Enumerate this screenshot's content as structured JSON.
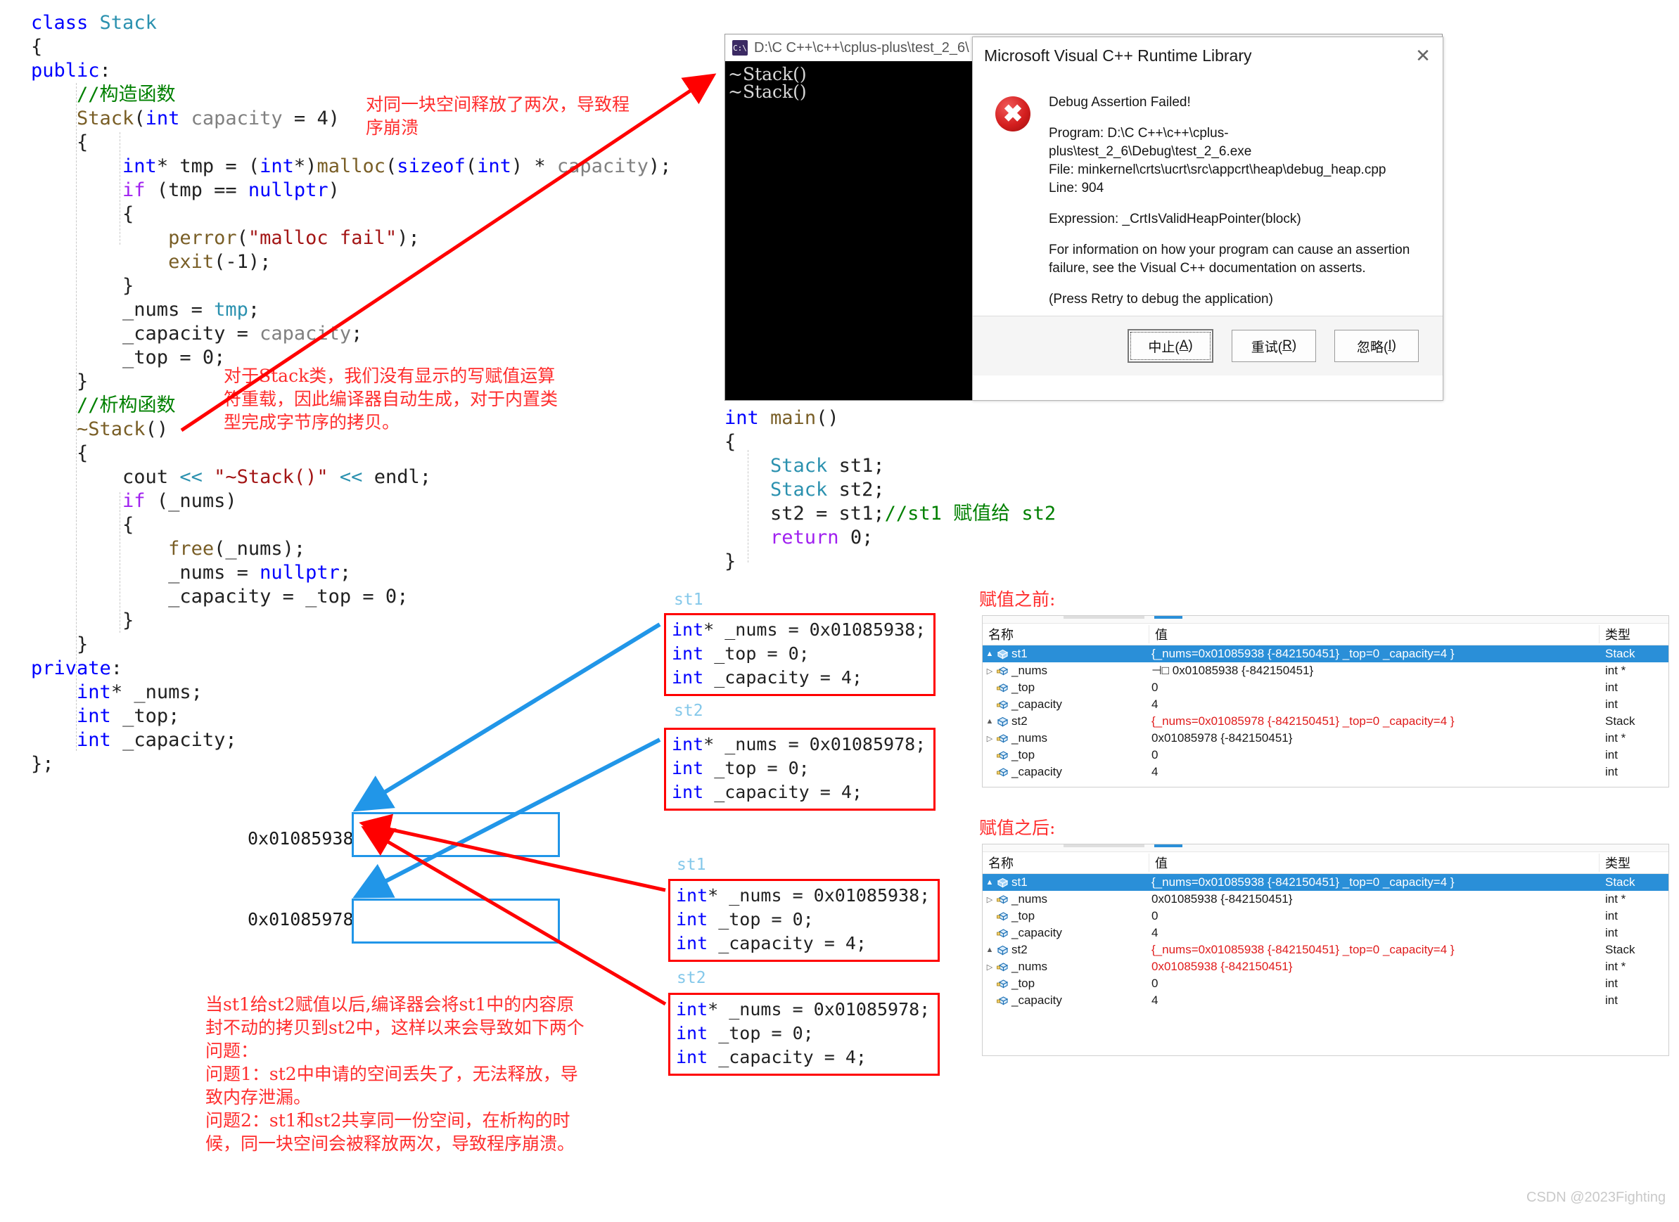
{
  "code_left": {
    "lines": [
      [
        {
          "t": "class ",
          "c": "kw"
        },
        {
          "t": "Stack",
          "c": "type"
        }
      ],
      [
        {
          "t": "{",
          "c": "plain"
        }
      ],
      [
        {
          "t": "public",
          "c": "kw"
        },
        {
          "t": ":",
          "c": "plain"
        }
      ],
      [
        {
          "t": "    //构造函数",
          "c": "cmt"
        }
      ],
      [
        {
          "t": "    ",
          "c": "plain"
        },
        {
          "t": "Stack",
          "c": "fn"
        },
        {
          "t": "(",
          "c": "plain"
        },
        {
          "t": "int ",
          "c": "kw"
        },
        {
          "t": "capacity",
          "c": "param"
        },
        {
          "t": " = ",
          "c": "plain"
        },
        {
          "t": "4",
          "c": "plain"
        },
        {
          "t": ")",
          "c": "plain"
        }
      ],
      [
        {
          "t": "    {",
          "c": "plain"
        }
      ],
      [
        {
          "t": "        ",
          "c": "plain"
        },
        {
          "t": "int",
          "c": "kw"
        },
        {
          "t": "* tmp = (",
          "c": "plain"
        },
        {
          "t": "int",
          "c": "kw"
        },
        {
          "t": "*)",
          "c": "plain"
        },
        {
          "t": "malloc",
          "c": "fn"
        },
        {
          "t": "(",
          "c": "plain"
        },
        {
          "t": "sizeof",
          "c": "kw"
        },
        {
          "t": "(",
          "c": "plain"
        },
        {
          "t": "int",
          "c": "kw"
        },
        {
          "t": ") * ",
          "c": "plain"
        },
        {
          "t": "capacity",
          "c": "param"
        },
        {
          "t": ");",
          "c": "plain"
        }
      ],
      [
        {
          "t": "        ",
          "c": "plain"
        },
        {
          "t": "if",
          "c": "kw2"
        },
        {
          "t": " (tmp == ",
          "c": "plain"
        },
        {
          "t": "nullptr",
          "c": "kw"
        },
        {
          "t": ")",
          "c": "plain"
        }
      ],
      [
        {
          "t": "        {",
          "c": "plain"
        }
      ],
      [
        {
          "t": "            ",
          "c": "plain"
        },
        {
          "t": "perror",
          "c": "fn"
        },
        {
          "t": "(",
          "c": "plain"
        },
        {
          "t": "\"malloc fail\"",
          "c": "str"
        },
        {
          "t": ");",
          "c": "plain"
        }
      ],
      [
        {
          "t": "            ",
          "c": "plain"
        },
        {
          "t": "exit",
          "c": "fn"
        },
        {
          "t": "(-1);",
          "c": "plain"
        }
      ],
      [
        {
          "t": "        }",
          "c": "plain"
        }
      ],
      [
        {
          "t": "        _nums = ",
          "c": "plain"
        },
        {
          "t": "tmp",
          "c": "type"
        },
        {
          "t": ";",
          "c": "plain"
        }
      ],
      [
        {
          "t": "        _capacity = ",
          "c": "plain"
        },
        {
          "t": "capacity",
          "c": "param"
        },
        {
          "t": ";",
          "c": "plain"
        }
      ],
      [
        {
          "t": "        _top = ",
          "c": "plain"
        },
        {
          "t": "0",
          "c": "plain"
        },
        {
          "t": ";",
          "c": "plain"
        }
      ],
      [
        {
          "t": "    }",
          "c": "plain"
        }
      ],
      [
        {
          "t": "    //析构函数",
          "c": "cmt"
        }
      ],
      [
        {
          "t": "    ",
          "c": "plain"
        },
        {
          "t": "~Stack",
          "c": "fn"
        },
        {
          "t": "()",
          "c": "plain"
        }
      ],
      [
        {
          "t": "    {",
          "c": "plain"
        }
      ],
      [
        {
          "t": "        ",
          "c": "plain"
        },
        {
          "t": "cout",
          "c": "plain"
        },
        {
          "t": " << ",
          "c": "type"
        },
        {
          "t": "\"~Stack()\"",
          "c": "str"
        },
        {
          "t": " << ",
          "c": "type"
        },
        {
          "t": "endl",
          "c": "plain"
        },
        {
          "t": ";",
          "c": "plain"
        }
      ],
      [
        {
          "t": "        ",
          "c": "plain"
        },
        {
          "t": "if",
          "c": "kw2"
        },
        {
          "t": " (_nums)",
          "c": "plain"
        }
      ],
      [
        {
          "t": "        {",
          "c": "plain"
        }
      ],
      [
        {
          "t": "            ",
          "c": "plain"
        },
        {
          "t": "free",
          "c": "fn"
        },
        {
          "t": "(_nums);",
          "c": "plain"
        }
      ],
      [
        {
          "t": "            _nums = ",
          "c": "plain"
        },
        {
          "t": "nullptr",
          "c": "kw"
        },
        {
          "t": ";",
          "c": "plain"
        }
      ],
      [
        {
          "t": "            _capacity = _top = ",
          "c": "plain"
        },
        {
          "t": "0",
          "c": "plain"
        },
        {
          "t": ";",
          "c": "plain"
        }
      ],
      [
        {
          "t": "        }",
          "c": "plain"
        }
      ],
      [
        {
          "t": "    }",
          "c": "plain"
        }
      ],
      [
        {
          "t": "private",
          "c": "kw"
        },
        {
          "t": ":",
          "c": "plain"
        }
      ],
      [
        {
          "t": "    ",
          "c": "plain"
        },
        {
          "t": "int",
          "c": "kw"
        },
        {
          "t": "* _nums;",
          "c": "plain"
        }
      ],
      [
        {
          "t": "    ",
          "c": "plain"
        },
        {
          "t": "int",
          "c": "kw"
        },
        {
          "t": " _top;",
          "c": "plain"
        }
      ],
      [
        {
          "t": "    ",
          "c": "plain"
        },
        {
          "t": "int",
          "c": "kw"
        },
        {
          "t": " _capacity;",
          "c": "plain"
        }
      ],
      [
        {
          "t": "};",
          "c": "plain"
        }
      ]
    ]
  },
  "code_main": {
    "lines": [
      [
        {
          "t": "int",
          "c": "kw"
        },
        {
          "t": " ",
          "c": "plain"
        },
        {
          "t": "main",
          "c": "fn"
        },
        {
          "t": "()",
          "c": "plain"
        }
      ],
      [
        {
          "t": "{",
          "c": "plain"
        }
      ],
      [
        {
          "t": "    ",
          "c": "plain"
        },
        {
          "t": "Stack",
          "c": "type"
        },
        {
          "t": " st1;",
          "c": "plain"
        }
      ],
      [
        {
          "t": "    ",
          "c": "plain"
        },
        {
          "t": "Stack",
          "c": "type"
        },
        {
          "t": " st2;",
          "c": "plain"
        }
      ],
      [
        {
          "t": "    st2 = st1;",
          "c": "plain"
        },
        {
          "t": "//st1 赋值给 st2",
          "c": "cmt"
        }
      ],
      [
        {
          "t": "    ",
          "c": "plain"
        },
        {
          "t": "return",
          "c": "kw2"
        },
        {
          "t": " 0;",
          "c": "plain"
        }
      ],
      [
        {
          "t": "}",
          "c": "plain"
        }
      ]
    ]
  },
  "annotations": {
    "top_right": "对同一块空间释放了两次，导致程\n序崩溃",
    "middle": "对于Stack类，我们没有显示的写赋值运算\n符重载，因此编译器自动生成，对于内置类\n型完成字节序的拷贝。",
    "bottom": "当st1给st2赋值以后,编译器会将st1中的内容原\n封不动的拷贝到st2中，这样以来会导致如下两个\n问题：\n问题1：st2中申请的空间丢失了，无法释放，导\n致内存泄漏。\n问题2：st1和st2共享同一份空间，在析构的时\n候，同一块空间会被释放两次，导致程序崩溃。"
  },
  "console": {
    "icon": "command-prompt-icon",
    "title": "D:\\C C++\\c++\\cplus-plus\\test_2_6\\",
    "output": "~Stack()\n~Stack()"
  },
  "dialog": {
    "title": "Microsoft Visual C++ Runtime Library",
    "close_glyph": "✕",
    "icon": "error-icon",
    "headline": "Debug Assertion Failed!",
    "program_line": "Program: D:\\C C++\\c++\\cplus-plus\\test_2_6\\Debug\\test_2_6.exe",
    "file_line": "File: minkernel\\crts\\ucrt\\src\\appcrt\\heap\\debug_heap.cpp",
    "line_line": "Line: 904",
    "expression_line": "Expression: _CrtIsValidHeapPointer(block)",
    "info_line_1": "For information on how your program can cause an assertion",
    "info_line_2": "failure, see the Visual C++ documentation on asserts.",
    "retry_hint": "(Press Retry to debug the application)",
    "buttons": [
      {
        "label_prefix": "中止(",
        "accel": "A",
        "label_suffix": ")",
        "name": "abort-button",
        "default": true
      },
      {
        "label_prefix": "重试(",
        "accel": "R",
        "label_suffix": ")",
        "name": "retry-button",
        "default": false
      },
      {
        "label_prefix": "忽略(",
        "accel": "I",
        "label_suffix": ")",
        "name": "ignore-button",
        "default": false
      }
    ]
  },
  "struct_boxes": {
    "before": [
      {
        "label": "st1",
        "lines": [
          [
            {
              "t": "int",
              "c": "kw"
            },
            {
              "t": "* _nums = 0x01085938;",
              "c": "plain"
            }
          ],
          [
            {
              "t": "int",
              "c": "kw"
            },
            {
              "t": " _top = 0;",
              "c": "plain"
            }
          ],
          [
            {
              "t": "int",
              "c": "kw"
            },
            {
              "t": " _capacity = 4;",
              "c": "plain"
            }
          ]
        ]
      },
      {
        "label": "st2",
        "lines": [
          [
            {
              "t": "int",
              "c": "kw"
            },
            {
              "t": "* _nums = 0x01085978;",
              "c": "plain"
            }
          ],
          [
            {
              "t": "int",
              "c": "kw"
            },
            {
              "t": " _top = 0;",
              "c": "plain"
            }
          ],
          [
            {
              "t": "int",
              "c": "kw"
            },
            {
              "t": " _capacity = 4;",
              "c": "plain"
            }
          ]
        ]
      }
    ],
    "after": [
      {
        "label": "st1",
        "lines": [
          [
            {
              "t": "int",
              "c": "kw"
            },
            {
              "t": "* _nums = 0x01085938;",
              "c": "plain"
            }
          ],
          [
            {
              "t": "int",
              "c": "kw"
            },
            {
              "t": " _top = 0;",
              "c": "plain"
            }
          ],
          [
            {
              "t": "int",
              "c": "kw"
            },
            {
              "t": " _capacity = 4;",
              "c": "plain"
            }
          ]
        ]
      },
      {
        "label": "st2",
        "lines": [
          [
            {
              "t": "int",
              "c": "kw"
            },
            {
              "t": "* _nums = 0x01085978;",
              "c": "plain"
            }
          ],
          [
            {
              "t": "int",
              "c": "kw"
            },
            {
              "t": " _top = 0;",
              "c": "plain"
            }
          ],
          [
            {
              "t": "int",
              "c": "kw"
            },
            {
              "t": " _capacity = 4;",
              "c": "plain"
            }
          ]
        ]
      }
    ]
  },
  "memory": {
    "block1_addr": "0x01085938",
    "block2_addr": "0x01085978"
  },
  "watch_before": {
    "caption": "赋值之前:",
    "headers": {
      "name": "名称",
      "value": "值",
      "type": "类型"
    },
    "rows": [
      {
        "indent": 1,
        "tri": "▲",
        "icon": "struct-icon",
        "name": "st1",
        "value": "{_nums=0x01085938 {-842150451} _top=0 _capacity=4 }",
        "type": "Stack",
        "selected": true,
        "red": false,
        "pin": false
      },
      {
        "indent": 2,
        "tri": "▷",
        "icon": "field-icon",
        "name": "_nums",
        "value": "0x01085938 {-842150451}",
        "type": "int *",
        "selected": false,
        "red": false,
        "pin": true
      },
      {
        "indent": 3,
        "tri": "",
        "icon": "field-icon",
        "name": "_top",
        "value": "0",
        "type": "int",
        "selected": false,
        "red": false,
        "pin": false
      },
      {
        "indent": 3,
        "tri": "",
        "icon": "field-icon",
        "name": "_capacity",
        "value": "4",
        "type": "int",
        "selected": false,
        "red": false,
        "pin": false
      },
      {
        "indent": 1,
        "tri": "▲",
        "icon": "struct-icon",
        "name": "st2",
        "value": "{_nums=0x01085978 {-842150451} _top=0 _capacity=4 }",
        "type": "Stack",
        "selected": false,
        "red": true,
        "pin": false
      },
      {
        "indent": 2,
        "tri": "▷",
        "icon": "field-icon",
        "name": "_nums",
        "value": "0x01085978 {-842150451}",
        "type": "int *",
        "selected": false,
        "red": false,
        "pin": false
      },
      {
        "indent": 3,
        "tri": "",
        "icon": "field-icon",
        "name": "_top",
        "value": "0",
        "type": "int",
        "selected": false,
        "red": false,
        "pin": false
      },
      {
        "indent": 3,
        "tri": "",
        "icon": "field-icon",
        "name": "_capacity",
        "value": "4",
        "type": "int",
        "selected": false,
        "red": false,
        "pin": false
      }
    ]
  },
  "watch_after": {
    "caption": "赋值之后:",
    "headers": {
      "name": "名称",
      "value": "值",
      "type": "类型"
    },
    "rows": [
      {
        "indent": 1,
        "tri": "▲",
        "icon": "struct-icon",
        "name": "st1",
        "value": "{_nums=0x01085938 {-842150451} _top=0 _capacity=4 }",
        "type": "Stack",
        "selected": true,
        "red": false,
        "pin": false
      },
      {
        "indent": 2,
        "tri": "▷",
        "icon": "field-icon",
        "name": "_nums",
        "value": "0x01085938 {-842150451}",
        "type": "int *",
        "selected": false,
        "red": false,
        "pin": false
      },
      {
        "indent": 3,
        "tri": "",
        "icon": "field-icon",
        "name": "_top",
        "value": "0",
        "type": "int",
        "selected": false,
        "red": false,
        "pin": false
      },
      {
        "indent": 3,
        "tri": "",
        "icon": "field-icon",
        "name": "_capacity",
        "value": "4",
        "type": "int",
        "selected": false,
        "red": false,
        "pin": false
      },
      {
        "indent": 1,
        "tri": "▲",
        "icon": "struct-icon",
        "name": "st2",
        "value": "{_nums=0x01085938 {-842150451} _top=0 _capacity=4 }",
        "type": "Stack",
        "selected": false,
        "red": true,
        "pin": false
      },
      {
        "indent": 2,
        "tri": "▷",
        "icon": "field-icon",
        "name": "_nums",
        "value": "0x01085938 {-842150451}",
        "type": "int *",
        "selected": false,
        "red": true,
        "pin": false
      },
      {
        "indent": 3,
        "tri": "",
        "icon": "field-icon",
        "name": "_top",
        "value": "0",
        "type": "int",
        "selected": false,
        "red": false,
        "pin": false
      },
      {
        "indent": 3,
        "tri": "",
        "icon": "field-icon",
        "name": "_capacity",
        "value": "4",
        "type": "int",
        "selected": false,
        "red": false,
        "pin": false
      }
    ]
  },
  "watermark": "CSDN @2023Fighting",
  "colors": {
    "annotation_red": "#ff2d2d",
    "box_red": "#ff0000",
    "arrow_blue": "#2196e8",
    "selection_blue": "#2a8fd8",
    "keyword_blue": "#0000ff",
    "type_teal": "#2b91af",
    "comment_green": "#008000"
  }
}
